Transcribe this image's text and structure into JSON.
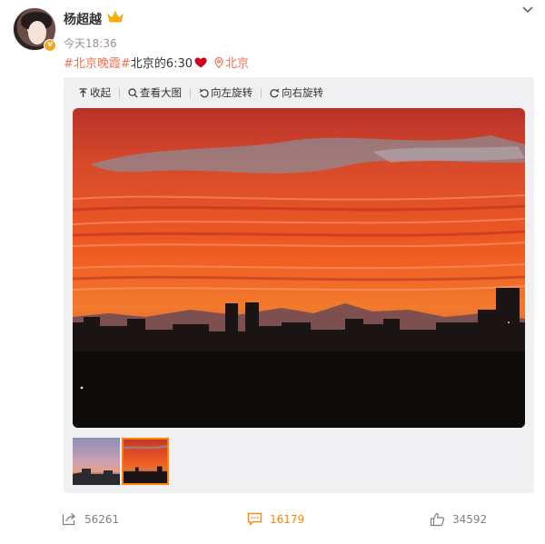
{
  "post": {
    "author": "杨超越",
    "verified_mark": "v",
    "time": "今天18:36",
    "content": {
      "topic": "#北京晚霞#",
      "text": " 北京的6:30",
      "location": "北京"
    }
  },
  "toolbar": {
    "collapse": "收起",
    "view_large": "查看大图",
    "rotate_left": "向左旋转",
    "rotate_right": "向右旋转"
  },
  "actions": {
    "shares": "56261",
    "comments": "16179",
    "likes": "34592"
  },
  "colors": {
    "accent": "#eb7350",
    "active": "#ff8200",
    "muted": "#939393"
  }
}
